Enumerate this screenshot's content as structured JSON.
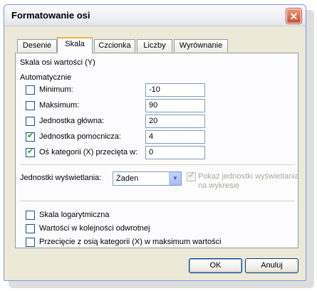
{
  "window": {
    "title": "Formatowanie osi",
    "close_glyph": "✕"
  },
  "tabs": [
    {
      "label": "Desenie",
      "active": false
    },
    {
      "label": "Skala",
      "active": true
    },
    {
      "label": "Czcionka",
      "active": false
    },
    {
      "label": "Liczby",
      "active": false
    },
    {
      "label": "Wyrównanie",
      "active": false
    }
  ],
  "scale": {
    "section_title": "Skala osi wartości (Y)",
    "auto_label": "Automatycznie",
    "rows": [
      {
        "label": "Minimum:",
        "checked": false,
        "value": "-10"
      },
      {
        "label": "Maksimum:",
        "checked": false,
        "value": "90"
      },
      {
        "label": "Jednostka główna:",
        "checked": false,
        "value": "20"
      },
      {
        "label": "Jednostka pomocnicza:",
        "checked": true,
        "value": "4"
      },
      {
        "label": "Oś kategorii (X)  przecięta w:",
        "checked": true,
        "value": "0"
      }
    ]
  },
  "display_units": {
    "label": "Jednostki wyświetlania:",
    "selected": "Żaden",
    "show_label_line1": "Pokaż jednostki wyświetlania",
    "show_label_line2": "na wykresie",
    "show_checked": true,
    "show_enabled": false
  },
  "options": [
    {
      "label": "Skala logarytmiczna",
      "checked": false
    },
    {
      "label": "Wartości w kolejności odwrotnej",
      "checked": false
    },
    {
      "label": "Przecięcie z osią kategorii (X) w maksimum wartości",
      "checked": false
    }
  ],
  "buttons": {
    "ok": "OK",
    "cancel": "Anuluj"
  },
  "colors": {
    "check": "#21a121",
    "active_tab_accent": "#f1b140",
    "close_button": "#c95236"
  }
}
